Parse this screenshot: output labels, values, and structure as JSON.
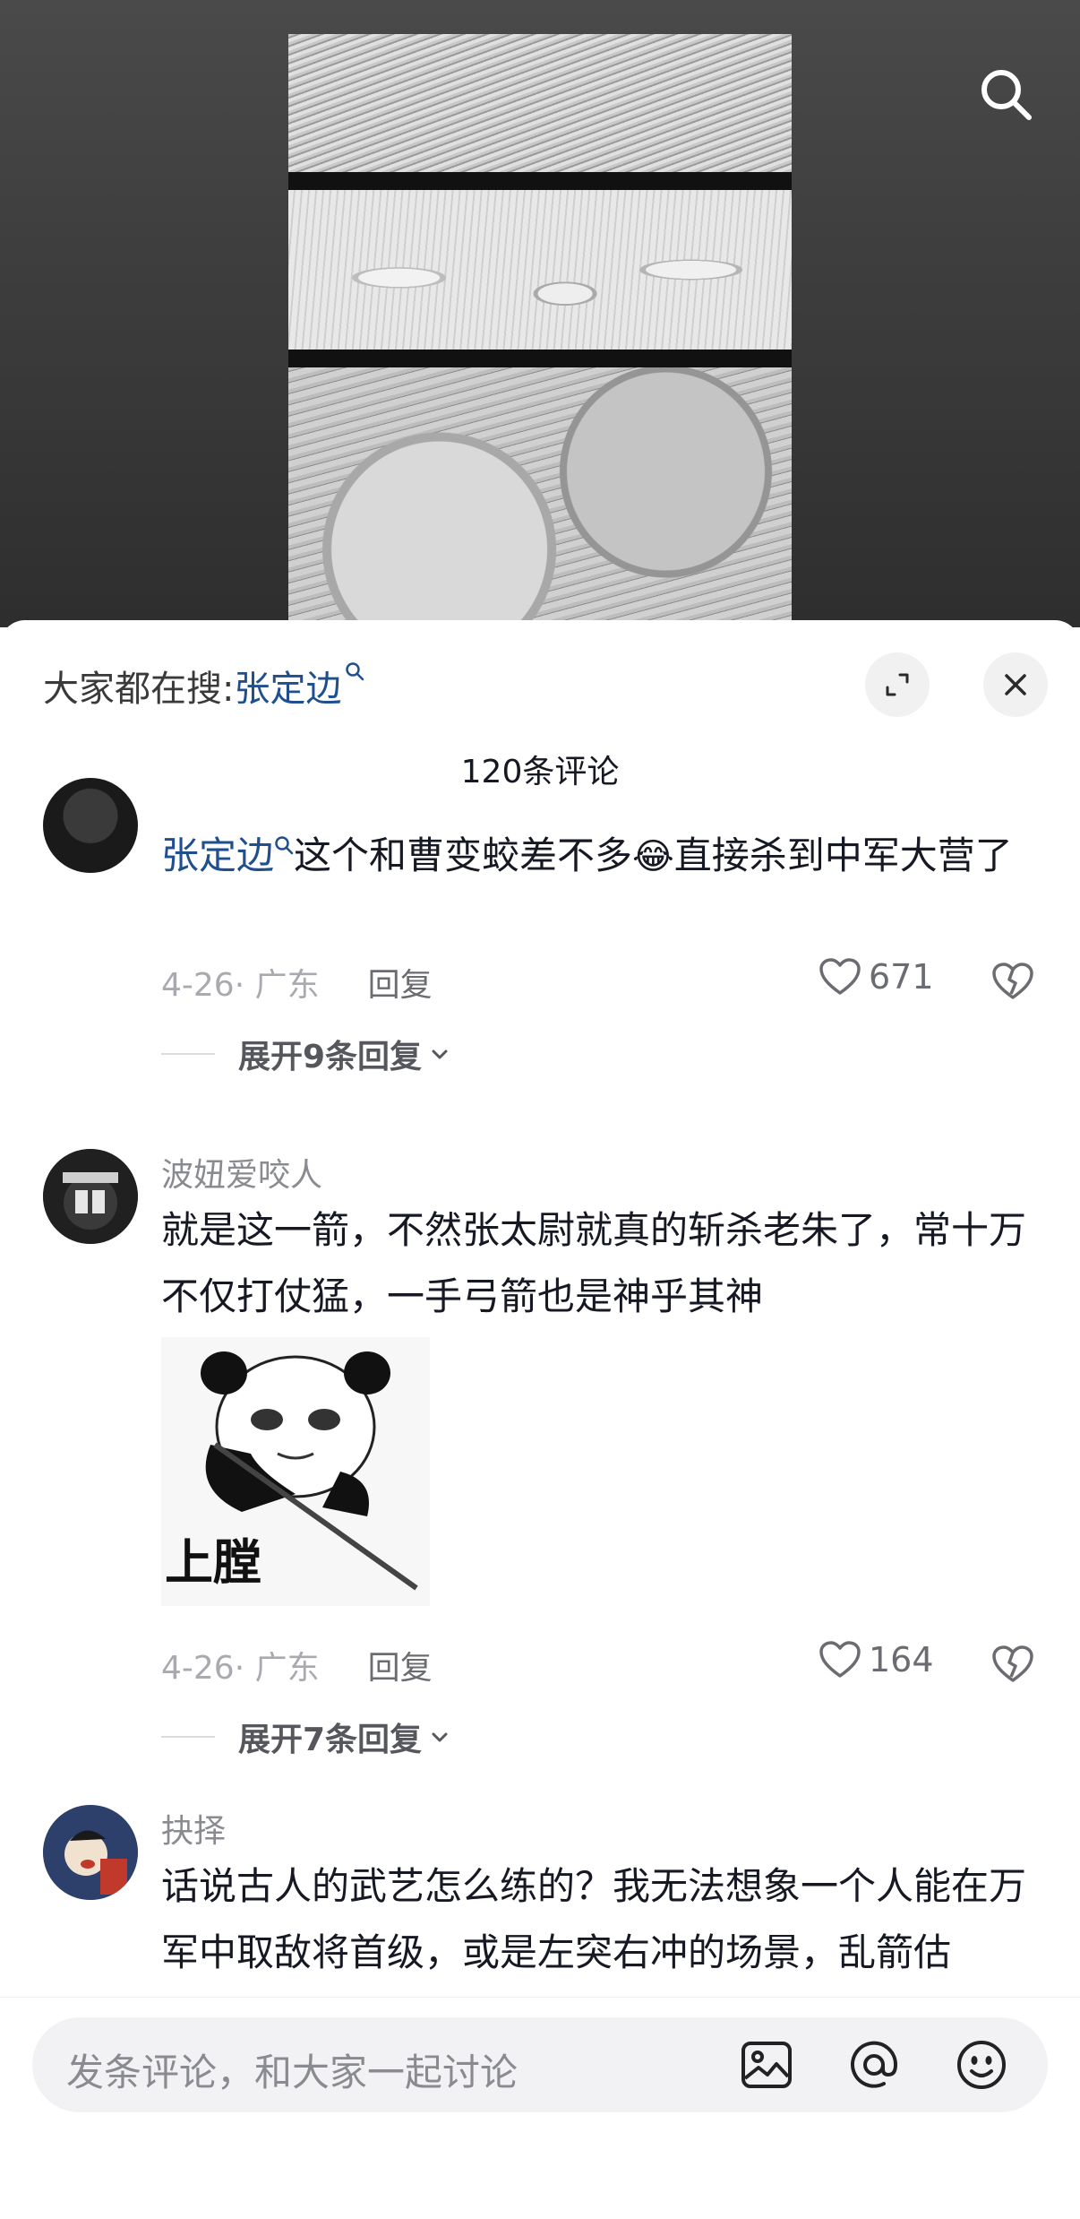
{
  "header": {
    "hot_search_prefix": "大家都在搜:",
    "hot_search_term": "张定边"
  },
  "comment_count": "120条评论",
  "comments": [
    {
      "author": "",
      "mention": "张定边",
      "text": "这个和曹变蛟差不多",
      "emoji": "😂",
      "text_after": "直接杀到中军大营了",
      "date_location": "4-26· 广东",
      "reply_label": "回复",
      "likes": "671",
      "expand_label": "展开9条回复"
    },
    {
      "author": "波妞爱咬人",
      "text": "就是这一箭，不然张太尉就真的斩杀老朱了，常十万不仅打仗猛，一手弓箭也是神乎其神",
      "sticker_caption": "上膛",
      "date_location": "4-26· 广东",
      "reply_label": "回复",
      "likes": "164",
      "expand_label": "展开7条回复"
    },
    {
      "author": "抉择",
      "text": "话说古人的武艺怎么练的？我无法想象一个人能在万军中取敌将首级，或是左突右冲的场景，乱箭估"
    }
  ],
  "input": {
    "placeholder": "发条评论，和大家一起讨论"
  },
  "icons": {
    "search": "search-icon",
    "expand": "expand-icon",
    "close": "close-icon",
    "like": "heart-icon",
    "dislike": "broken-heart-icon",
    "image": "image-icon",
    "mention": "at-icon",
    "emoji": "emoji-icon"
  },
  "colors": {
    "link": "#1f4f8f",
    "muted": "#a9aab0",
    "input_bg": "#f2f2f4"
  }
}
